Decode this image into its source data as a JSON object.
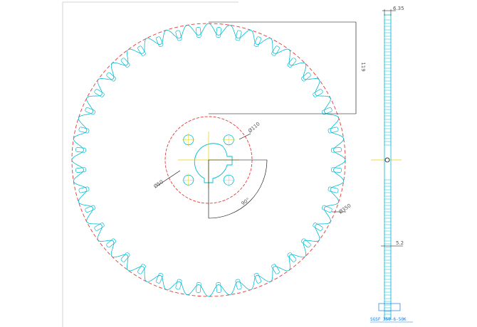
{
  "drawing": {
    "part_number": "SGSF 350-6-50K",
    "logo_text": "SGSF",
    "tooth_count": 40,
    "bolt_hole_count": 4,
    "colors": {
      "outline": "#00bcd4",
      "center_line": "#e53935",
      "dimension": "#000000",
      "axis_yellow": "#e5d000",
      "border": "#bdbdbd"
    },
    "dimensions": {
      "thickness": "6.35",
      "tooth_depth": "119",
      "bolt_circle": "Ø110",
      "bore": "Ø50",
      "angle": "90°",
      "outer": "Ø350",
      "slot_width": "5.2"
    }
  }
}
